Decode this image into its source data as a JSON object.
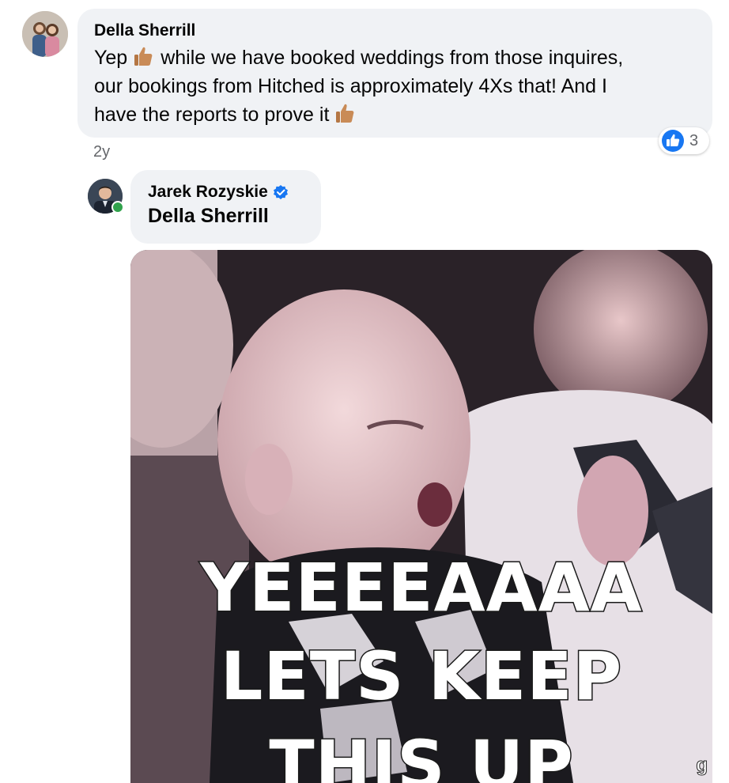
{
  "comment": {
    "author": "Della Sherrill",
    "text_part1": "Yep",
    "text_part2": "while we have booked weddings from those inquires,",
    "text_line2": "our bookings from Hitched is approximately 4Xs that! And I",
    "text_line3": "have the reports to prove it",
    "emoji": "thumbs-up-icon",
    "timestamp": "2y",
    "reaction_count": "3",
    "reaction_icon": "like-icon"
  },
  "reply": {
    "author": "Jarek Rozyskie",
    "verified_icon": "verified-badge-icon",
    "mention": "Della Sherrill",
    "online_status_color": "#31a24c"
  },
  "gif": {
    "caption_line1": "YEEEEAAAA",
    "caption_line2": "LETS KEEP",
    "caption_line3": "THIS UP",
    "badge": "g"
  },
  "colors": {
    "bubble": "#f0f2f5",
    "secondary_text": "#65676b",
    "like_blue": "#1877f2"
  }
}
